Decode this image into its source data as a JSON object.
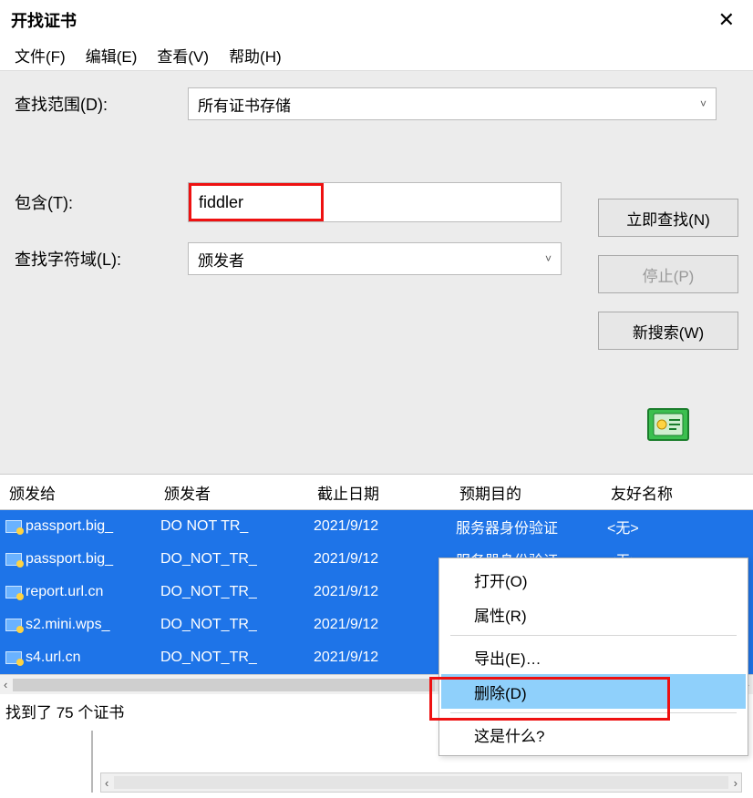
{
  "title": "开找证书",
  "close_glyph": "✕",
  "menu": {
    "file": "文件(F)",
    "edit": "编辑(E)",
    "view": "查看(V)",
    "help": "帮助(H)"
  },
  "labels": {
    "scope": "查找范围(D):",
    "contains": "包含(T):",
    "field": "查找字符域(L):"
  },
  "scope_combo": {
    "value": "所有证书存储",
    "chev": "˅"
  },
  "contains_value": "fiddler",
  "field_combo": {
    "value": "颁发者",
    "chev": "˅"
  },
  "buttons": {
    "find_now": "立即查找(N)",
    "stop": "停止(P)",
    "new_search": "新搜索(W)"
  },
  "columns": {
    "issued_to": "颁发给",
    "issuer": "颁发者",
    "expire": "截止日期",
    "purpose": "预期目的",
    "friendly": "友好名称"
  },
  "rows": [
    {
      "issued_to": "passport.big_",
      "issuer": "DO NOT TR_",
      "expire": "2021/9/12",
      "purpose": "服务器身份验证",
      "friendly": "<无>"
    },
    {
      "issued_to": "passport.big_",
      "issuer": "DO_NOT_TR_",
      "expire": "2021/9/12",
      "purpose": "服务器身份验证",
      "friendly": "<无>"
    },
    {
      "issued_to": "report.url.cn",
      "issuer": "DO_NOT_TR_",
      "expire": "2021/9/12",
      "purpose": "",
      "friendly": ""
    },
    {
      "issued_to": "s2.mini.wps_",
      "issuer": "DO_NOT_TR_",
      "expire": "2021/9/12",
      "purpose": "",
      "friendly": ""
    },
    {
      "issued_to": "s4.url.cn",
      "issuer": "DO_NOT_TR_",
      "expire": "2021/9/12",
      "purpose": "",
      "friendly": ""
    }
  ],
  "hscroll": {
    "left": "‹",
    "right": "›"
  },
  "status": "找到了 75 个证书",
  "context_menu": {
    "open": "打开(O)",
    "properties": "属性(R)",
    "export": "导出(E)…",
    "delete": "删除(D)",
    "whats_this": "这是什么?"
  },
  "vscroll_caret": "^"
}
